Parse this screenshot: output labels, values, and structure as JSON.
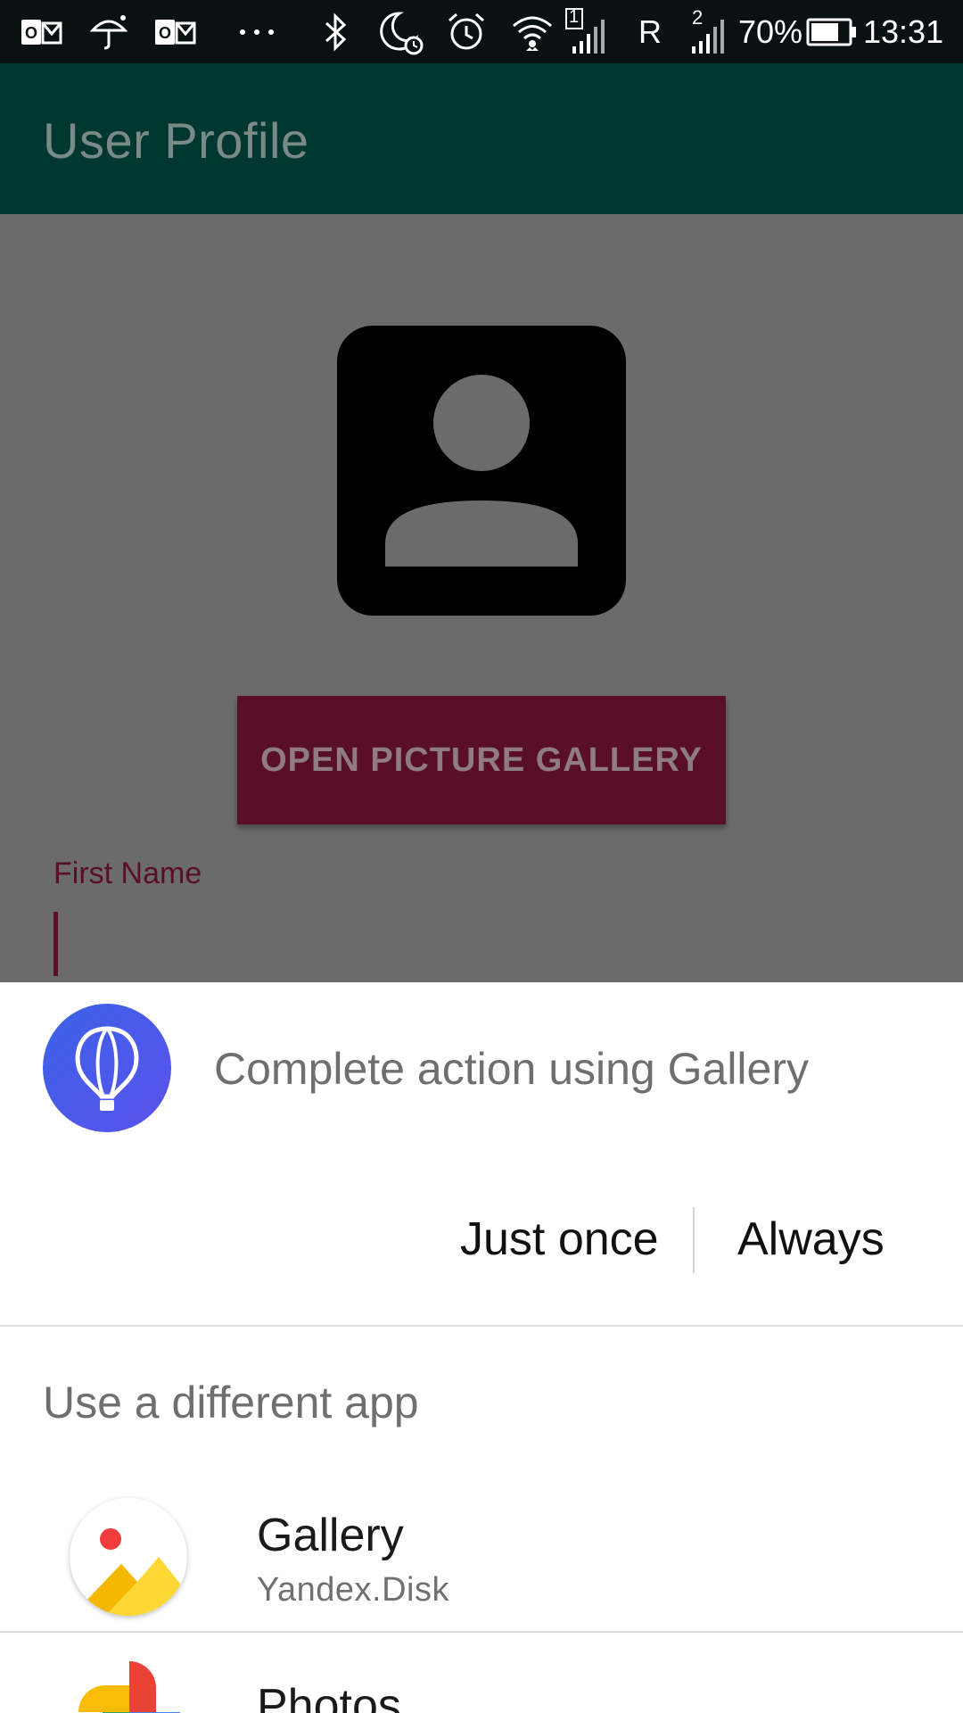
{
  "status_bar": {
    "sim1_label": "1",
    "roaming": "R",
    "sim2_label": "2",
    "battery": "70%",
    "time": "13:31",
    "icons": [
      "outlook-icon",
      "umbrella-icon",
      "outlook-icon",
      "more-icon",
      "bluetooth-icon",
      "do-not-disturb-icon",
      "alarm-icon",
      "wifi-icon",
      "signal-icon",
      "battery-icon"
    ]
  },
  "app_bar": {
    "title": "User Profile"
  },
  "profile": {
    "open_gallery_label": "OPEN PICTURE GALLERY",
    "first_name_label": "First Name"
  },
  "chooser": {
    "title": "Complete action using Gallery",
    "just_once_label": "Just once",
    "always_label": "Always",
    "different_app_label": "Use a different app",
    "apps": [
      {
        "name": "Gallery",
        "subtitle": "Yandex.Disk",
        "icon": "gallery-app-icon"
      },
      {
        "name": "Photos",
        "icon": "google-photos-icon"
      }
    ]
  },
  "colors": {
    "app_bar": "#003731",
    "accent": "#5a0f28",
    "scrim": "#6b6b6b",
    "chooser_icon": "#4a5ae9"
  }
}
